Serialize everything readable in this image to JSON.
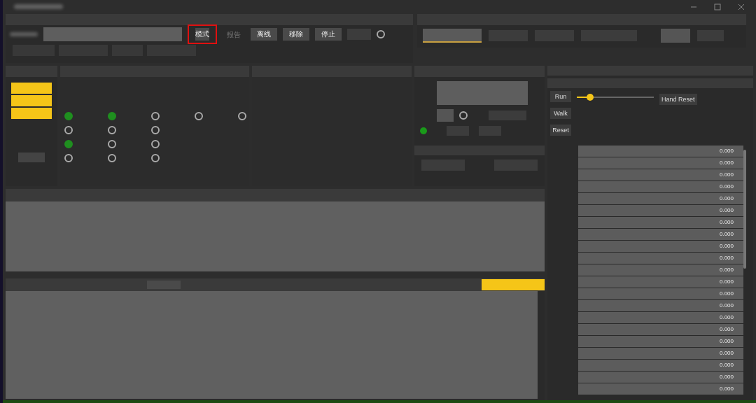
{
  "toolbar": [
    {
      "label": "模式",
      "kind": "button",
      "highlighted": true
    },
    {
      "label": "报告",
      "kind": "text",
      "highlighted": false
    },
    {
      "label": "离线",
      "kind": "button",
      "highlighted": false
    },
    {
      "label": "移除",
      "kind": "button",
      "highlighted": false
    },
    {
      "label": "停止",
      "kind": "button",
      "highlighted": false
    }
  ],
  "options": [
    [
      {
        "selected": true
      },
      {
        "selected": true
      },
      {
        "selected": false
      },
      {
        "selected": false
      },
      {
        "selected": false
      }
    ],
    [
      {
        "selected": false
      },
      {
        "selected": false
      },
      {
        "selected": false
      }
    ],
    [
      {
        "selected": true
      },
      {
        "selected": false
      },
      {
        "selected": false
      }
    ],
    [
      {
        "selected": false
      },
      {
        "selected": false
      },
      {
        "selected": false
      }
    ]
  ],
  "connection_option": {
    "selected": false
  },
  "control_option": {
    "selected": false
  },
  "motion": {
    "buttons": [
      "Run",
      "Walk",
      "Reset"
    ],
    "slider": {
      "level": 0.17
    },
    "hand_reset": "Hand Reset"
  },
  "values": [
    "0.000",
    "0.000",
    "0.000",
    "0.000",
    "0.000",
    "0.000",
    "0.000",
    "0.000",
    "0.000",
    "0.000",
    "0.000",
    "0.000",
    "0.000",
    "0.000",
    "0.000",
    "0.000",
    "0.000",
    "0.000",
    "0.000",
    "0.000",
    "0.000"
  ]
}
